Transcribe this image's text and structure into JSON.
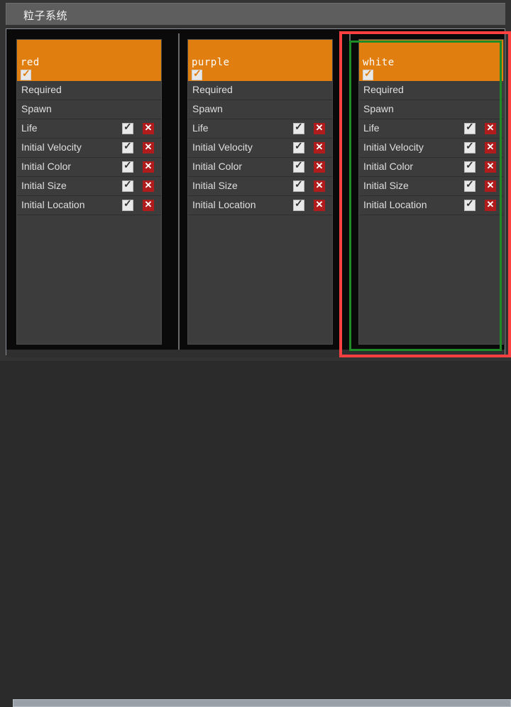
{
  "window": {
    "title": "粒子系统"
  },
  "scrollbar": {
    "horizontal_label": "horizontal-scrollbar"
  },
  "colors": {
    "emitter_header": "#e07e10",
    "row_background": "#3c3c3c",
    "panel_background": "#0a0a0a",
    "selection_outer": "#ff4040",
    "selection_inner": "#1f8b26",
    "delete_button": "#b01c1c",
    "titlebar": "#5e5e5e"
  },
  "icons": {
    "checkbox_checked": "checkmark-icon",
    "delete": "close-x-icon"
  },
  "panels": [
    {
      "name": "red",
      "enabled": true,
      "selected": false,
      "rows": [
        {
          "label": "Required",
          "section": true,
          "checked": false,
          "deletable": false
        },
        {
          "label": "Spawn",
          "section": true,
          "checked": false,
          "deletable": false
        },
        {
          "label": "Life",
          "section": false,
          "checked": true,
          "deletable": true
        },
        {
          "label": "Initial Velocity",
          "section": false,
          "checked": true,
          "deletable": true
        },
        {
          "label": "Initial Color",
          "section": false,
          "checked": true,
          "deletable": true
        },
        {
          "label": "Initial Size",
          "section": false,
          "checked": true,
          "deletable": true
        },
        {
          "label": "Initial Location",
          "section": false,
          "checked": true,
          "deletable": true
        }
      ]
    },
    {
      "name": "purple",
      "enabled": true,
      "selected": false,
      "rows": [
        {
          "label": "Required",
          "section": true,
          "checked": false,
          "deletable": false
        },
        {
          "label": "Spawn",
          "section": true,
          "checked": false,
          "deletable": false
        },
        {
          "label": "Life",
          "section": false,
          "checked": true,
          "deletable": true
        },
        {
          "label": "Initial Velocity",
          "section": false,
          "checked": true,
          "deletable": true
        },
        {
          "label": "Initial Color",
          "section": false,
          "checked": true,
          "deletable": true
        },
        {
          "label": "Initial Size",
          "section": false,
          "checked": true,
          "deletable": true
        },
        {
          "label": "Initial Location",
          "section": false,
          "checked": true,
          "deletable": true
        }
      ]
    },
    {
      "name": "white",
      "enabled": true,
      "selected": true,
      "rows": [
        {
          "label": "Required",
          "section": true,
          "checked": false,
          "deletable": false
        },
        {
          "label": "Spawn",
          "section": true,
          "checked": false,
          "deletable": false
        },
        {
          "label": "Life",
          "section": false,
          "checked": true,
          "deletable": true
        },
        {
          "label": "Initial Velocity",
          "section": false,
          "checked": true,
          "deletable": true
        },
        {
          "label": "Initial Color",
          "section": false,
          "checked": true,
          "deletable": true
        },
        {
          "label": "Initial Size",
          "section": false,
          "checked": true,
          "deletable": true
        },
        {
          "label": "Initial Location",
          "section": false,
          "checked": true,
          "deletable": true
        }
      ]
    }
  ]
}
